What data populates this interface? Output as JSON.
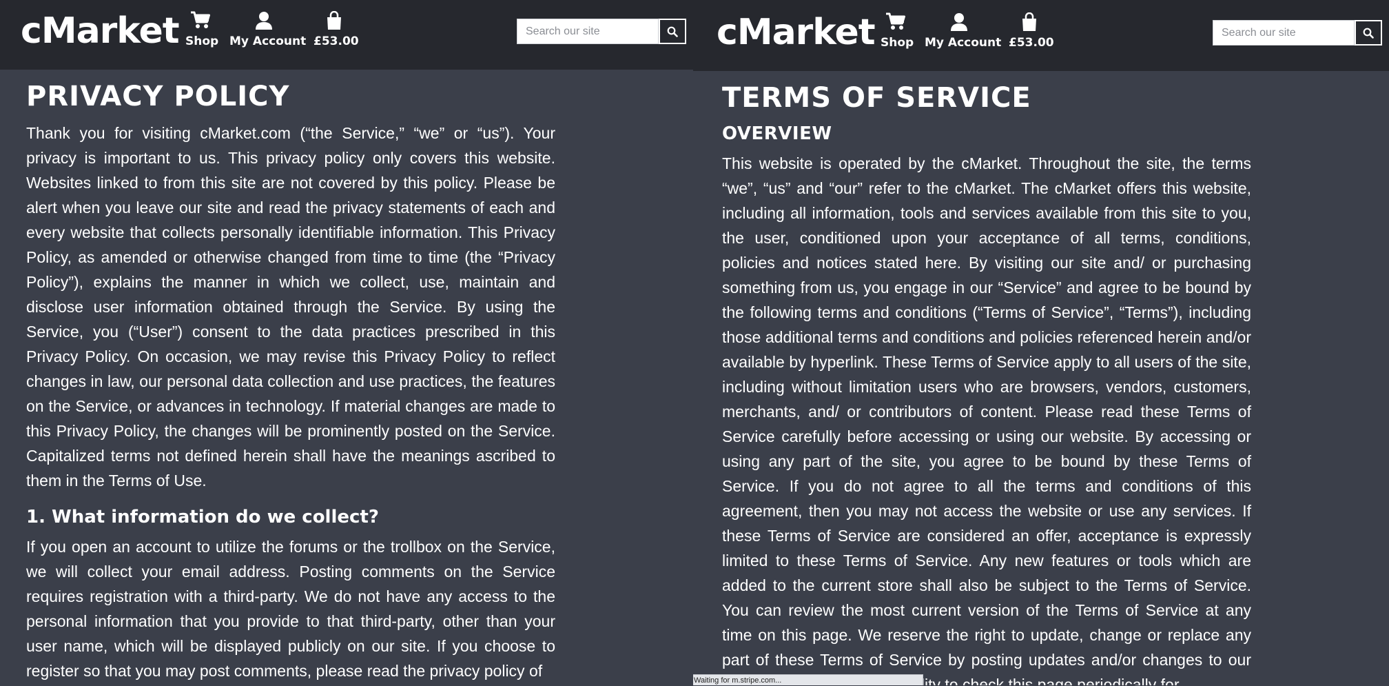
{
  "left_pane": {
    "header": {
      "logo": "cMarket",
      "nav": [
        {
          "label": "Shop",
          "icon": "shopping-cart-icon"
        },
        {
          "label": "My Account",
          "icon": "user-icon"
        },
        {
          "label": "£53.00",
          "icon": "shopping-bag-icon"
        }
      ],
      "search": {
        "placeholder": "Search our site",
        "value": "",
        "button_icon": "search-icon"
      }
    },
    "main": {
      "title": "PRIVACY POLICY",
      "intro": "Thank you for visiting cMarket.com (“the Service,” “we” or “us”). Your privacy is important to us. This privacy policy only covers this website. Websites linked to from this site are not covered by this policy. Please be alert when you leave our site and read the privacy statements of each and every website that collects personally identifiable information. This Privacy Policy, as amended or otherwise changed from time to time (the “Privacy Policy”), explains the manner in which we collect, use, maintain and disclose user information obtained through the Service. By using the Service, you (“User”) consent to the data practices prescribed in this Privacy Policy. On occasion, we may revise this Privacy Policy to reflect changes in law, our personal data collection and use practices, the features on the Service, or advances in technology. If material changes are made to this Privacy Policy, the changes will be prominently posted on the Service. Capitalized terms not defined herein shall have the meanings ascribed to them in the Terms of Use.",
      "section1_title": "1. What information do we collect?",
      "section1_text": "If you open an account to utilize the forums or the trollbox on the Service, we will collect your email address. Posting comments on the Service requires registration with a third-party. We do not have any access to the personal information that you provide to that third-party, other than your user name, which will be displayed publicly on our site. If you choose to register so that you may post comments, please read the privacy policy of"
    }
  },
  "right_pane": {
    "header": {
      "logo": "cMarket",
      "nav": [
        {
          "label": "Shop",
          "icon": "shopping-cart-icon"
        },
        {
          "label": "My Account",
          "icon": "user-icon"
        },
        {
          "label": "£53.00",
          "icon": "shopping-bag-icon"
        }
      ],
      "search": {
        "placeholder": "Search our site",
        "value": "",
        "button_icon": "search-icon"
      }
    },
    "main": {
      "title": "TERMS OF SERVICE",
      "subtitle": "OVERVIEW",
      "text": "This website is operated by the cMarket. Throughout the site, the terms “we”, “us” and “our” refer to the cMarket. The cMarket offers this website, including all information, tools and services available from this site to you, the user, conditioned upon your acceptance of all terms, conditions, policies and notices stated here. By visiting our site and/ or purchasing something from us, you engage in our “Service” and agree to be bound by the following terms and conditions (“Terms of Service”, “Terms”), including those additional terms and conditions and policies referenced herein and/or available by hyperlink. These Terms of Service apply to all users of the site, including without limitation users who are browsers, vendors, customers, merchants, and/ or contributors of content. Please read these Terms of Service carefully before accessing or using our website. By accessing or using any part of the site, you agree to be bound by these Terms of Service. If you do not agree to all the terms and conditions of this agreement, then you may not access the website or use any services. If these Terms of Service are considered an offer, acceptance is expressly limited to these Terms of Service. Any new features or tools which are added to the current store shall also be subject to the Terms of Service. You can review the most current version of the Terms of Service at any time on this page. We reserve the right to update, change or replace any part of these Terms of Service by posting updates and/or changes to our website. It is your responsibility to check this page periodically for"
    }
  },
  "status_bar": {
    "text": "Waiting for m.stripe.com..."
  },
  "colors": {
    "nav_bg": "#26282e",
    "page_bg": "#3b3f4a",
    "text": "#ffffff"
  }
}
